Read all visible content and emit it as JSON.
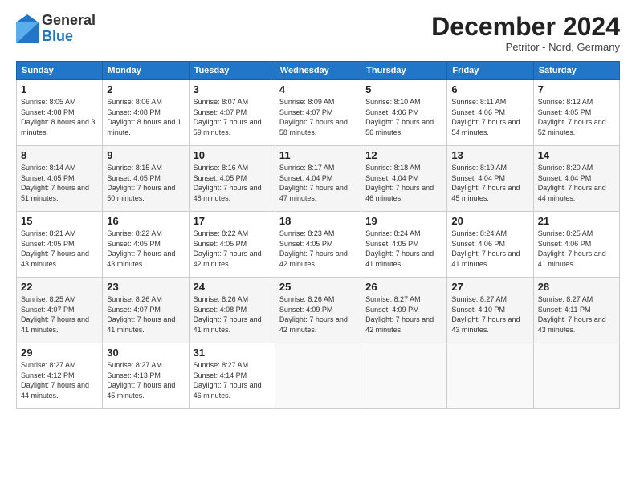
{
  "logo": {
    "general": "General",
    "blue": "Blue"
  },
  "header": {
    "month": "December 2024",
    "location": "Petritor - Nord, Germany"
  },
  "weekdays": [
    "Sunday",
    "Monday",
    "Tuesday",
    "Wednesday",
    "Thursday",
    "Friday",
    "Saturday"
  ],
  "weeks": [
    [
      {
        "day": "1",
        "sunrise": "Sunrise: 8:05 AM",
        "sunset": "Sunset: 4:08 PM",
        "daylight": "Daylight: 8 hours and 3 minutes."
      },
      {
        "day": "2",
        "sunrise": "Sunrise: 8:06 AM",
        "sunset": "Sunset: 4:08 PM",
        "daylight": "Daylight: 8 hours and 1 minute."
      },
      {
        "day": "3",
        "sunrise": "Sunrise: 8:07 AM",
        "sunset": "Sunset: 4:07 PM",
        "daylight": "Daylight: 7 hours and 59 minutes."
      },
      {
        "day": "4",
        "sunrise": "Sunrise: 8:09 AM",
        "sunset": "Sunset: 4:07 PM",
        "daylight": "Daylight: 7 hours and 58 minutes."
      },
      {
        "day": "5",
        "sunrise": "Sunrise: 8:10 AM",
        "sunset": "Sunset: 4:06 PM",
        "daylight": "Daylight: 7 hours and 56 minutes."
      },
      {
        "day": "6",
        "sunrise": "Sunrise: 8:11 AM",
        "sunset": "Sunset: 4:06 PM",
        "daylight": "Daylight: 7 hours and 54 minutes."
      },
      {
        "day": "7",
        "sunrise": "Sunrise: 8:12 AM",
        "sunset": "Sunset: 4:05 PM",
        "daylight": "Daylight: 7 hours and 52 minutes."
      }
    ],
    [
      {
        "day": "8",
        "sunrise": "Sunrise: 8:14 AM",
        "sunset": "Sunset: 4:05 PM",
        "daylight": "Daylight: 7 hours and 51 minutes."
      },
      {
        "day": "9",
        "sunrise": "Sunrise: 8:15 AM",
        "sunset": "Sunset: 4:05 PM",
        "daylight": "Daylight: 7 hours and 50 minutes."
      },
      {
        "day": "10",
        "sunrise": "Sunrise: 8:16 AM",
        "sunset": "Sunset: 4:05 PM",
        "daylight": "Daylight: 7 hours and 48 minutes."
      },
      {
        "day": "11",
        "sunrise": "Sunrise: 8:17 AM",
        "sunset": "Sunset: 4:04 PM",
        "daylight": "Daylight: 7 hours and 47 minutes."
      },
      {
        "day": "12",
        "sunrise": "Sunrise: 8:18 AM",
        "sunset": "Sunset: 4:04 PM",
        "daylight": "Daylight: 7 hours and 46 minutes."
      },
      {
        "day": "13",
        "sunrise": "Sunrise: 8:19 AM",
        "sunset": "Sunset: 4:04 PM",
        "daylight": "Daylight: 7 hours and 45 minutes."
      },
      {
        "day": "14",
        "sunrise": "Sunrise: 8:20 AM",
        "sunset": "Sunset: 4:04 PM",
        "daylight": "Daylight: 7 hours and 44 minutes."
      }
    ],
    [
      {
        "day": "15",
        "sunrise": "Sunrise: 8:21 AM",
        "sunset": "Sunset: 4:05 PM",
        "daylight": "Daylight: 7 hours and 43 minutes."
      },
      {
        "day": "16",
        "sunrise": "Sunrise: 8:22 AM",
        "sunset": "Sunset: 4:05 PM",
        "daylight": "Daylight: 7 hours and 43 minutes."
      },
      {
        "day": "17",
        "sunrise": "Sunrise: 8:22 AM",
        "sunset": "Sunset: 4:05 PM",
        "daylight": "Daylight: 7 hours and 42 minutes."
      },
      {
        "day": "18",
        "sunrise": "Sunrise: 8:23 AM",
        "sunset": "Sunset: 4:05 PM",
        "daylight": "Daylight: 7 hours and 42 minutes."
      },
      {
        "day": "19",
        "sunrise": "Sunrise: 8:24 AM",
        "sunset": "Sunset: 4:05 PM",
        "daylight": "Daylight: 7 hours and 41 minutes."
      },
      {
        "day": "20",
        "sunrise": "Sunrise: 8:24 AM",
        "sunset": "Sunset: 4:06 PM",
        "daylight": "Daylight: 7 hours and 41 minutes."
      },
      {
        "day": "21",
        "sunrise": "Sunrise: 8:25 AM",
        "sunset": "Sunset: 4:06 PM",
        "daylight": "Daylight: 7 hours and 41 minutes."
      }
    ],
    [
      {
        "day": "22",
        "sunrise": "Sunrise: 8:25 AM",
        "sunset": "Sunset: 4:07 PM",
        "daylight": "Daylight: 7 hours and 41 minutes."
      },
      {
        "day": "23",
        "sunrise": "Sunrise: 8:26 AM",
        "sunset": "Sunset: 4:07 PM",
        "daylight": "Daylight: 7 hours and 41 minutes."
      },
      {
        "day": "24",
        "sunrise": "Sunrise: 8:26 AM",
        "sunset": "Sunset: 4:08 PM",
        "daylight": "Daylight: 7 hours and 41 minutes."
      },
      {
        "day": "25",
        "sunrise": "Sunrise: 8:26 AM",
        "sunset": "Sunset: 4:09 PM",
        "daylight": "Daylight: 7 hours and 42 minutes."
      },
      {
        "day": "26",
        "sunrise": "Sunrise: 8:27 AM",
        "sunset": "Sunset: 4:09 PM",
        "daylight": "Daylight: 7 hours and 42 minutes."
      },
      {
        "day": "27",
        "sunrise": "Sunrise: 8:27 AM",
        "sunset": "Sunset: 4:10 PM",
        "daylight": "Daylight: 7 hours and 43 minutes."
      },
      {
        "day": "28",
        "sunrise": "Sunrise: 8:27 AM",
        "sunset": "Sunset: 4:11 PM",
        "daylight": "Daylight: 7 hours and 43 minutes."
      }
    ],
    [
      {
        "day": "29",
        "sunrise": "Sunrise: 8:27 AM",
        "sunset": "Sunset: 4:12 PM",
        "daylight": "Daylight: 7 hours and 44 minutes."
      },
      {
        "day": "30",
        "sunrise": "Sunrise: 8:27 AM",
        "sunset": "Sunset: 4:13 PM",
        "daylight": "Daylight: 7 hours and 45 minutes."
      },
      {
        "day": "31",
        "sunrise": "Sunrise: 8:27 AM",
        "sunset": "Sunset: 4:14 PM",
        "daylight": "Daylight: 7 hours and 46 minutes."
      },
      null,
      null,
      null,
      null
    ]
  ]
}
